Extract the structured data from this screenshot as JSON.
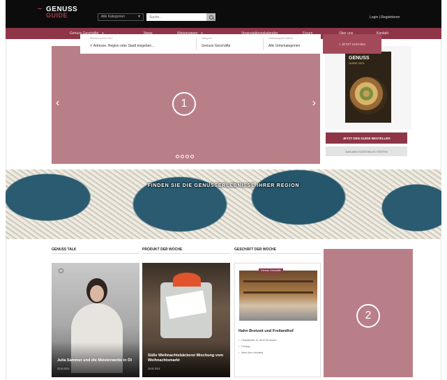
{
  "header": {
    "logo_top": "GENUSS",
    "logo_bottom": "GUIDE",
    "category_select": "Alle Kategorien",
    "search_placeholder": "Suche...",
    "login": "Login | Registrieren"
  },
  "nav": [
    {
      "label": "Genuss Geschäfte",
      "dropdown": true
    },
    {
      "label": "News",
      "dropdown": false
    },
    {
      "label": "Weingruppen",
      "dropdown": true
    },
    {
      "label": "Veranstaltungskalender",
      "dropdown": false
    },
    {
      "label": "Forum",
      "dropdown": false
    },
    {
      "label": "Über uns",
      "dropdown": false
    },
    {
      "label": "Kontakt",
      "dropdown": false
    }
  ],
  "slider": {
    "badge": "1",
    "prev": "‹",
    "next": "›",
    "dot_count": 4
  },
  "guide": {
    "cover_title": "GENUSS",
    "cover_subtitle": "GUIDE 2021",
    "order_button": "JETZT DEN GUIDE BESTELLEN",
    "trial_button": "DAS ABO KOSTENLOS TESTEN"
  },
  "hero": {
    "heading": "FINDEN SIE DIE GENUSSERLEBNISSE IHRER REGION",
    "fields": [
      {
        "label": "Wonach suchen Sie?",
        "value": "Adresse, Region oder Stadt eingeben...",
        "icon": "map-pin-icon"
      },
      {
        "label": "Kategorie",
        "value": "Genuss Geschäfte"
      },
      {
        "label": "Unterkategorie wählen",
        "value": "Alle Unterkategorien"
      }
    ],
    "submit": "JETZT SUCHEN"
  },
  "columns": {
    "talk": {
      "title": "GENUSS TALK",
      "caption": "Julia Sammer und die Meisterwerke in Öl",
      "date": "23.02.2021"
    },
    "product": {
      "title": "PRODUKT DER WOCHE",
      "caption": "Süße Weihnachtsbäckerei Mischung vom Weihnachtsmarkt",
      "date": "23.02.2021"
    },
    "shop": {
      "title": "GESCHÄFT DER WOCHE",
      "tag": "Genuss Geschäfte",
      "name": "Hahn Brotzeit und Freilandhof",
      "details": [
        "Hauptstraße 12, 8010 Kirchbach",
        "Freutag",
        "Mehr über Hahnfeld"
      ]
    }
  },
  "ad": {
    "badge": "2"
  },
  "colors": {
    "brand": "#8e3648",
    "placeholder": "#b97f88"
  }
}
